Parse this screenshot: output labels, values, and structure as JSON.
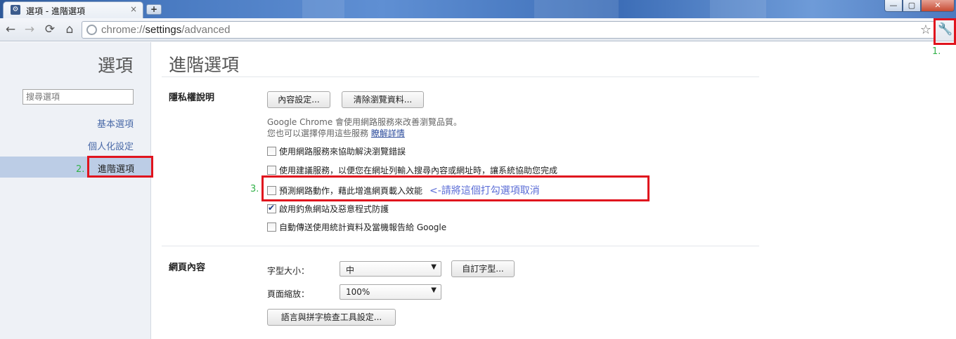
{
  "tab": {
    "title": "選項 - 進階選項",
    "close": "×"
  },
  "window": {
    "minimize": "—",
    "maximize": "▢",
    "close": "✕"
  },
  "toolbar": {
    "url_scheme": "chrome://",
    "url_host": "settings",
    "url_path": "/advanced",
    "back_icon": "←",
    "forward_icon": "→",
    "reload_icon": "⟳",
    "home_icon": "⌂",
    "star_icon": "☆",
    "wrench_icon": "🔧"
  },
  "sidebar": {
    "title": "選項",
    "search_placeholder": "搜尋選項",
    "items": [
      {
        "label": "基本選項"
      },
      {
        "label": "個人化設定"
      },
      {
        "label": "進階選項"
      }
    ]
  },
  "main": {
    "title": "進階選項",
    "privacy": {
      "title": "隱私權說明",
      "content_settings_button": "內容設定...",
      "clear_data_button": "清除瀏覽資料...",
      "desc_line1": "Google Chrome 會使用網路服務來改善瀏覽品質。",
      "desc_line2": "您也可以選擇停用這些服務",
      "learn_more": "瞭解詳情",
      "options": [
        {
          "label": "使用網路服務來協助解決瀏覽錯誤",
          "checked": false
        },
        {
          "label": "使用建議服務，以便您在網址列輸入搜尋內容或網址時，讓系統協助您完成",
          "checked": false
        },
        {
          "label": "預測網路動作，藉此增進網頁載入效能",
          "checked": false
        },
        {
          "label": "啟用釣魚網站及惡意程式防護",
          "checked": true
        },
        {
          "label": "自動傳送使用統計資料及當機報告給 Google",
          "checked": false
        }
      ],
      "note": "<-請將這個打勾選項取消"
    },
    "web_content": {
      "title": "網頁內容",
      "font_size_label": "字型大小：",
      "font_size_value": "中",
      "custom_fonts_button": "自訂字型...",
      "zoom_label": "頁面縮放：",
      "zoom_value": "100%",
      "language_button": "語言與拼字檢查工具設定..."
    }
  },
  "annotations": {
    "step1": "1.",
    "step2": "2.",
    "step3": "3."
  },
  "colors": {
    "highlight_box": "#e0141e",
    "annotation": "#33b24a",
    "note_text": "#5a6cd6",
    "sidebar_selected": "#bccde6"
  }
}
